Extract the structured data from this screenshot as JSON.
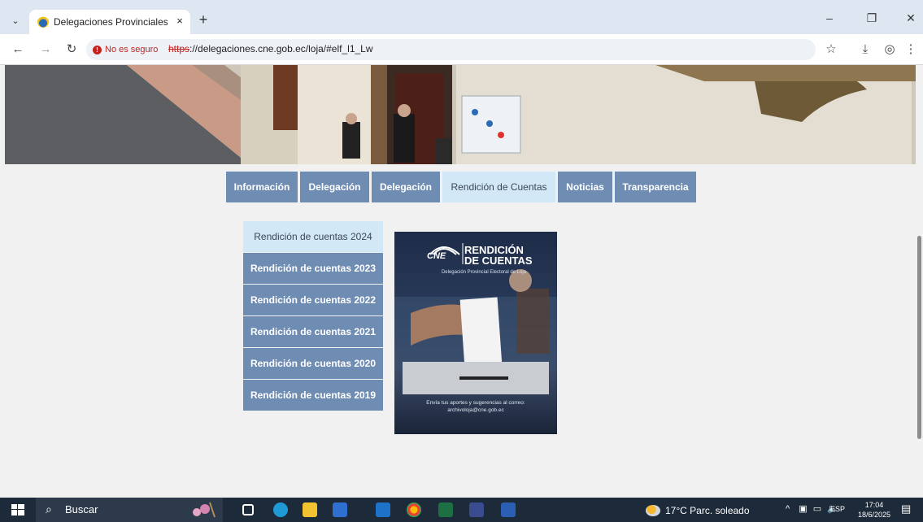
{
  "browser": {
    "tab": {
      "title": "Delegaciones Provinciales – Loj",
      "close": "×"
    },
    "new_tab": "+",
    "tab_menu": "⌄",
    "window_controls": {
      "minimize": "–",
      "restore": "❐",
      "close": "✕"
    },
    "nav": {
      "back": "←",
      "forward": "→",
      "reload": "↻"
    },
    "security_label": "No es seguro",
    "url_scheme": "https",
    "url_rest": "://delegaciones.cne.gob.ec/loja/#elf_l1_Lw",
    "toolbar_icons": {
      "bookmark": "☆",
      "download": "⤓",
      "profile": "◎",
      "menu": "⋮"
    }
  },
  "site": {
    "menu": [
      {
        "label": "Información",
        "active": false
      },
      {
        "label": "Delegación",
        "active": false
      },
      {
        "label": "Delegación",
        "active": false
      },
      {
        "label": "Rendición de Cuentas",
        "active": true
      },
      {
        "label": "Noticias",
        "active": false
      },
      {
        "label": "Transparencia",
        "active": false
      }
    ],
    "years": [
      {
        "label": "Rendición de cuentas 2024",
        "active": true
      },
      {
        "label": "Rendición de cuentas 2023",
        "active": false
      },
      {
        "label": "Rendición de cuentas 2022",
        "active": false
      },
      {
        "label": "Rendición de cuentas 2021",
        "active": false
      },
      {
        "label": "Rendición de cuentas 2020",
        "active": false
      },
      {
        "label": "Rendición de cuentas 2019",
        "active": false
      }
    ],
    "poster": {
      "logo_line1": "RENDICIÓN",
      "logo_line2": "DE CUENTAS",
      "cne": "CNE",
      "subtitle": "Delegación Provincial Electoral de Loja",
      "caption": "Envía tus aportes y sugerencias al correo: archivoloja@cne.gob.ec"
    }
  },
  "taskbar": {
    "search_label": "Buscar",
    "weather": "17°C  Parc. soleado",
    "language": "ESP",
    "time": "17:04",
    "date": "18/6/2025",
    "tray_arrow": "^"
  }
}
